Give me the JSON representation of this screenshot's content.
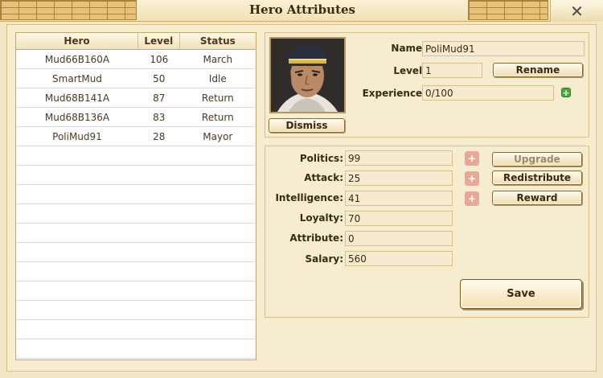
{
  "window": {
    "title": "Hero Attributes",
    "close_symbol": "✕"
  },
  "hero_table": {
    "headers": {
      "hero": "Hero",
      "level": "Level",
      "status": "Status"
    },
    "rows": [
      {
        "hero": "Mud66B160A",
        "level": "106",
        "status": "March"
      },
      {
        "hero": "SmartMud",
        "level": "50",
        "status": "Idle"
      },
      {
        "hero": "Mud68B141A",
        "level": "87",
        "status": "Return"
      },
      {
        "hero": "Mud68B136A",
        "level": "83",
        "status": "Return"
      },
      {
        "hero": "PoliMud91",
        "level": "28",
        "status": "Mayor"
      }
    ]
  },
  "profile": {
    "name_label": "Name:",
    "name": "PoliMud91",
    "level_label": "Level:",
    "level": "1",
    "experience_label": "Experience:",
    "experience": "0/100",
    "rename_button": "Rename",
    "dismiss_button": "Dismiss"
  },
  "stats": {
    "politics_label": "Politics:",
    "politics": "99",
    "attack_label": "Attack:",
    "attack": "25",
    "intelligence_label": "Intelligence:",
    "intelligence": "41",
    "loyalty_label": "Loyalty:",
    "loyalty": "70",
    "attribute_label": "Attribute:",
    "attribute": "0",
    "salary_label": "Salary:",
    "salary": "560",
    "upgrade_button": "Upgrade",
    "redistribute_button": "Redistribute",
    "reward_button": "Reward",
    "save_button": "Save",
    "plus_symbol": "+"
  },
  "colors": {
    "accent_green": "#4aa83a",
    "plus_disabled": "#e8a898"
  }
}
